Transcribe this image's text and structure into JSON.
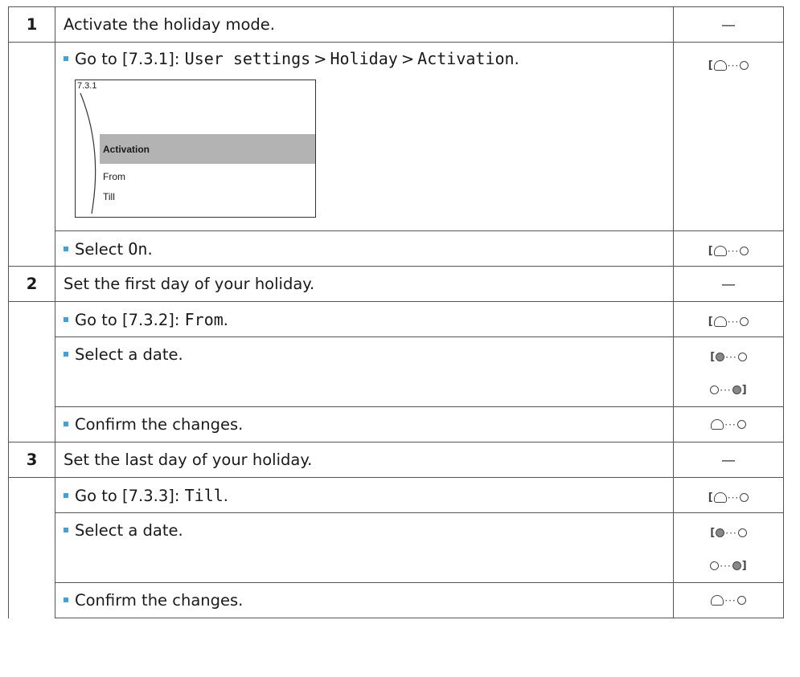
{
  "steps": [
    {
      "number": "1",
      "title": "Activate the holiday mode.",
      "sub": {
        "goto_prefix": "Go to [7.3.1]:",
        "path": [
          "User settings",
          "Holiday",
          "Activation"
        ],
        "path_sep": ">",
        "end": ".",
        "screen": {
          "path": "7.3.1",
          "items": [
            "Activation",
            "From",
            "Till"
          ]
        },
        "select_prefix": "Select",
        "select_value": "On",
        "select_end": "."
      }
    },
    {
      "number": "2",
      "title": "Set the first day of your holiday.",
      "goto_prefix": "Go to [7.3.2]:",
      "goto_value": "From",
      "goto_end": ".",
      "select_date": "Select a date.",
      "confirm": "Confirm the changes."
    },
    {
      "number": "3",
      "title": "Set the last day of your holiday.",
      "goto_prefix": "Go to [7.3.3]:",
      "goto_value": "Till",
      "goto_end": ".",
      "select_date": "Select a date.",
      "confirm": "Confirm the changes."
    }
  ],
  "dash": "—",
  "colors": {
    "bullet": "#3aa3e0",
    "highlight": "#b3b3b3",
    "border": "#555555"
  }
}
